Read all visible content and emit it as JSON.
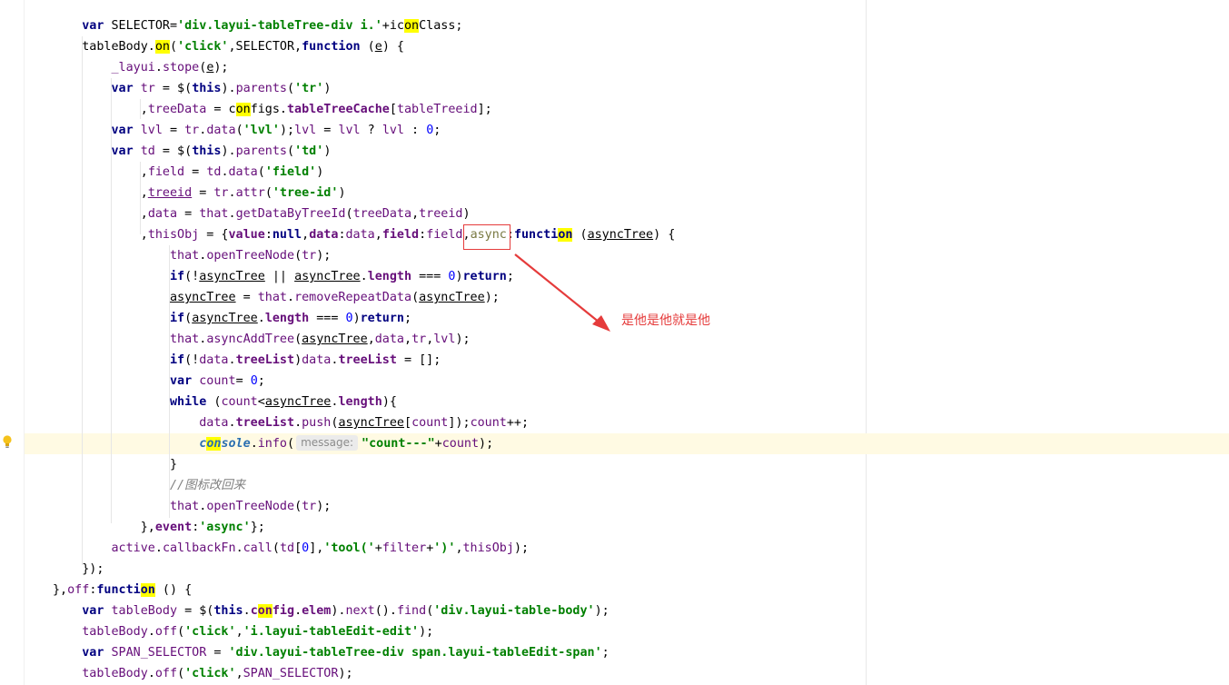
{
  "editor": {
    "gutter_icon": "lightbulb-icon",
    "hint_label": "message:",
    "annotation_text": "是他是他就是他",
    "annotation_color": "#e53b3b",
    "highlight_color": "#ffff00",
    "caret_row_color": "#fffae3"
  },
  "code_lines": [
    [
      [
        "    ",
        ""
      ],
      [
        "var",
        "k"
      ],
      [
        " SELECTOR=",
        ""
      ],
      [
        "'div.",
        ""
      ],
      [
        "s:'div.layui-tableTree-div i.'",
        "s"
      ]
    ],
    [
      [
        "",
        ""
      ]
    ]
  ]
}
